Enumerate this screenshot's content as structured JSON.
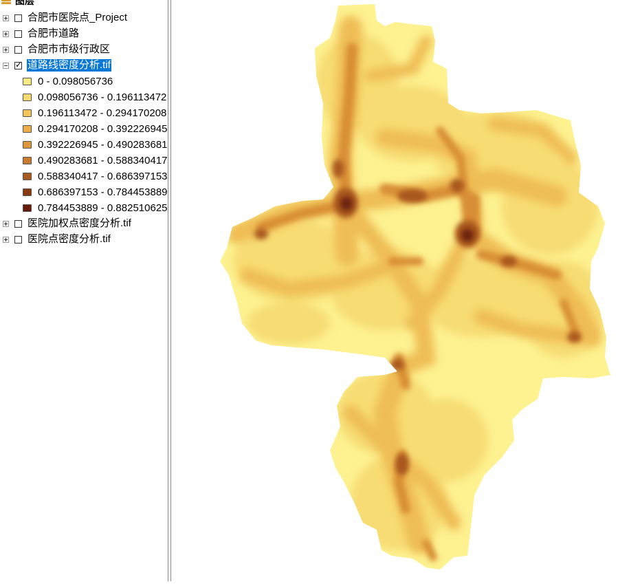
{
  "toc": {
    "header_title": "图层",
    "layers": [
      {
        "name": "合肥市医院点_Project",
        "checked": false,
        "expanded": false
      },
      {
        "name": "合肥市道路",
        "checked": false,
        "expanded": false
      },
      {
        "name": "合肥市市级行政区",
        "checked": false,
        "expanded": false
      },
      {
        "name": "道路线密度分析.tif",
        "checked": true,
        "expanded": true,
        "selected": true
      },
      {
        "name": "医院加权点密度分析.tif",
        "checked": false,
        "expanded": false
      },
      {
        "name": "医院点密度分析.tif",
        "checked": false,
        "expanded": false
      }
    ],
    "legend": [
      {
        "label": "0 - 0.098056736",
        "color": "#fbeb83"
      },
      {
        "label": "0.098056736 - 0.196113472",
        "color": "#f7da6f"
      },
      {
        "label": "0.196113472 - 0.294170208",
        "color": "#f3c65c"
      },
      {
        "label": "0.294170208 - 0.392226945",
        "color": "#ebae48"
      },
      {
        "label": "0.392226945 - 0.490283681",
        "color": "#de963a"
      },
      {
        "label": "0.490283681 - 0.588340417",
        "color": "#c97a2e"
      },
      {
        "label": "0.588340417 - 0.686397153",
        "color": "#a95a20"
      },
      {
        "label": "0.686397153 - 0.784453889",
        "color": "#883a12"
      },
      {
        "label": "0.784453889 - 0.882510625",
        "color": "#661c08"
      }
    ]
  },
  "map": {
    "colors": {
      "base": "#fdf190",
      "low": "#f8dd74",
      "mid": "#efbd55",
      "high": "#d88e36",
      "vhigh": "#a9561f",
      "peak": "#6b200b"
    }
  }
}
